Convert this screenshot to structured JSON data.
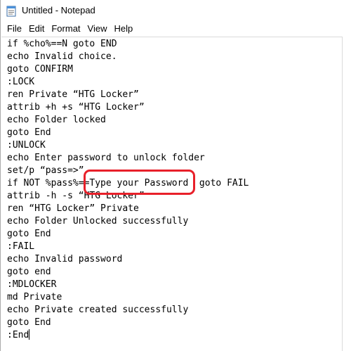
{
  "window": {
    "title": "Untitled - Notepad",
    "icon": "notepad-icon"
  },
  "menu": [
    "File",
    "Edit",
    "Format",
    "View",
    "Help"
  ],
  "editor": {
    "lines": [
      "if %cho%==N goto END",
      "echo Invalid choice.",
      "goto CONFIRM",
      ":LOCK",
      "ren Private “HTG Locker”",
      "attrib +h +s “HTG Locker”",
      "echo Folder locked",
      "goto End",
      ":UNLOCK",
      "echo Enter password to unlock folder",
      "set/p “pass=>”",
      "if NOT %pass%==Type your Password  goto FAIL",
      "attrib -h -s “HTG Locker”",
      "ren “HTG Locker” Private",
      "echo Folder Unlocked successfully",
      "goto End",
      ":FAIL",
      "echo Invalid password",
      "goto end",
      ":MDLOCKER",
      "md Private",
      "echo Private created successfully",
      "goto End",
      ":End"
    ],
    "highlight_color": "#e8202a"
  }
}
